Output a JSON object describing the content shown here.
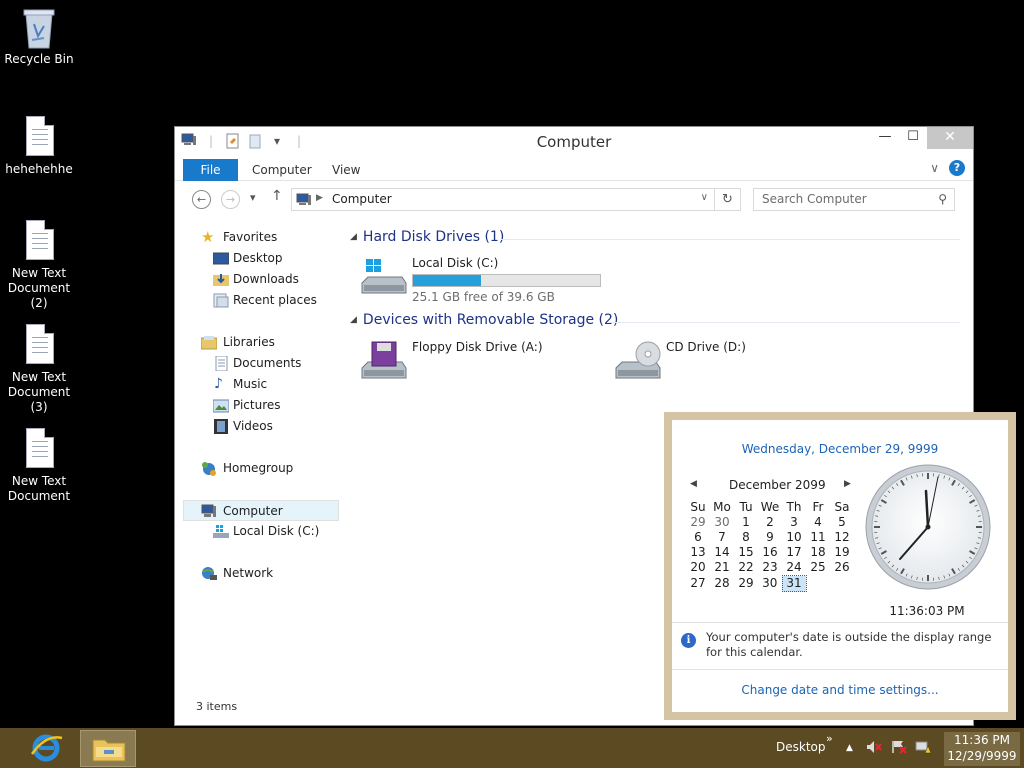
{
  "desktop": {
    "icons": [
      {
        "label": "Recycle Bin"
      },
      {
        "label": "hehehehhe"
      },
      {
        "label": "New Text Document (2)"
      },
      {
        "label": "New Text Document (3)"
      },
      {
        "label": "New Text Document"
      }
    ]
  },
  "window": {
    "title": "Computer",
    "controls": {
      "minimize": "—",
      "maximize": "☐",
      "close": "✕"
    },
    "ribbon_tabs": [
      "File",
      "Computer",
      "View"
    ],
    "address": "Computer",
    "search_placeholder": "Search Computer",
    "nav": {
      "favorites": "Favorites",
      "desktop": "Desktop",
      "downloads": "Downloads",
      "recent": "Recent places",
      "libraries": "Libraries",
      "documents": "Documents",
      "music": "Music",
      "pictures": "Pictures",
      "videos": "Videos",
      "homegroup": "Homegroup",
      "computer": "Computer",
      "local_disk": "Local Disk (C:)",
      "network": "Network"
    },
    "groups": {
      "hdd": "Hard Disk Drives (1)",
      "removable": "Devices with Removable Storage (2)"
    },
    "drives": {
      "c": {
        "name": "Local Disk (C:)",
        "free": "25.1 GB free of 39.6 GB",
        "used_fraction": 0.366
      },
      "a": {
        "name": "Floppy Disk Drive (A:)"
      },
      "d": {
        "name": "CD Drive (D:)"
      }
    },
    "status": "3 items"
  },
  "calendar": {
    "long_date": "Wednesday, December 29, 9999",
    "month_label": "December 2099",
    "weekdays": [
      "Su",
      "Mo",
      "Tu",
      "We",
      "Th",
      "Fr",
      "Sa"
    ],
    "weeks": [
      [
        "29",
        "30",
        "1",
        "2",
        "3",
        "4",
        "5"
      ],
      [
        "6",
        "7",
        "8",
        "9",
        "10",
        "11",
        "12"
      ],
      [
        "13",
        "14",
        "15",
        "16",
        "17",
        "18",
        "19"
      ],
      [
        "20",
        "21",
        "22",
        "23",
        "24",
        "25",
        "26"
      ],
      [
        "27",
        "28",
        "29",
        "30",
        "31",
        "",
        ""
      ]
    ],
    "time": "11:36:03 PM",
    "info": "Your computer's date is outside the display range for this calendar.",
    "link": "Change date and time settings..."
  },
  "taskbar": {
    "desktop_label": "Desktop",
    "chevron": "»",
    "time": "11:36 PM",
    "date": "12/29/9999"
  }
}
